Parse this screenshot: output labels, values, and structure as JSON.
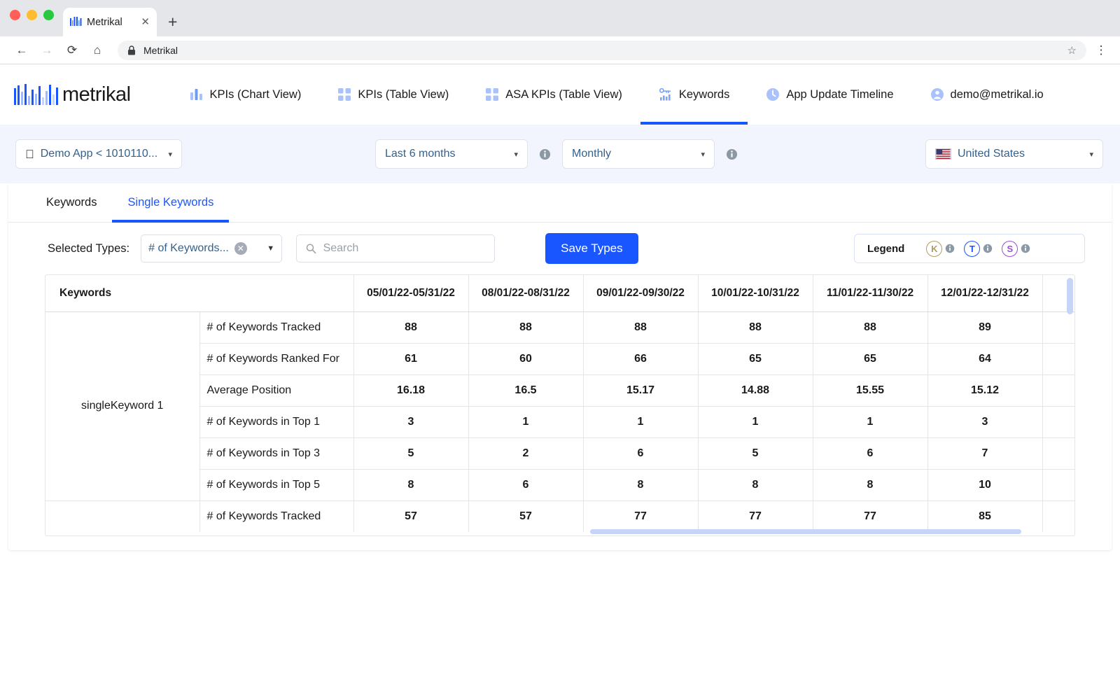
{
  "browser": {
    "tab_title": "Metrikal",
    "tab_close": "✕",
    "new_tab": "+",
    "back_icon": "←",
    "forward_icon": "→",
    "reload_icon": "⟳",
    "home_icon": "⌂",
    "lock_icon": "lock-icon",
    "url_text": "Metrikal",
    "bookmark_icon": "☆",
    "menu_icon": "⋮"
  },
  "header": {
    "logo_text": "metrikal",
    "nav": [
      {
        "label": "KPIs (Chart View)",
        "icon": "bar-chart-icon",
        "active": false
      },
      {
        "label": "KPIs (Table View)",
        "icon": "grid-icon",
        "active": false
      },
      {
        "label": "ASA KPIs (Table View)",
        "icon": "grid-icon",
        "active": false
      },
      {
        "label": "Keywords",
        "icon": "key-chart-icon",
        "active": true
      },
      {
        "label": "App Update Timeline",
        "icon": "clock-icon",
        "active": false
      },
      {
        "label": "demo@metrikal.io",
        "icon": "user-icon",
        "active": false
      }
    ]
  },
  "filters": {
    "app_selector": "Demo App < 1010110...",
    "app_icon": "apple-icon",
    "date_range": "Last 6 months",
    "granularity": "Monthly",
    "country": "United States",
    "country_flag": "us-flag-icon",
    "info_icon": "info-icon",
    "caret_icon": "▼"
  },
  "card": {
    "tabs": [
      {
        "label": "Keywords",
        "active": false
      },
      {
        "label": "Single Keywords",
        "active": true
      }
    ],
    "toolbar": {
      "selected_types_label": "Selected Types:",
      "selected_types_value": "# of Keywords...",
      "clear_icon": "✕",
      "dropdown_caret": "▼",
      "search_placeholder": "Search",
      "search_value": "",
      "search_icon": "search-icon",
      "save_button": "Save Types"
    },
    "legend": {
      "title": "Legend",
      "items": [
        {
          "letter": "K",
          "color": "#b09b63"
        },
        {
          "letter": "T",
          "color": "#1a56ff"
        },
        {
          "letter": "S",
          "color": "#9b4dd8"
        }
      ],
      "info_icon": "info-icon"
    }
  },
  "table": {
    "keywords_header": "Keywords",
    "periods": [
      "05/01/22-05/31/22",
      "08/01/22-08/31/22",
      "09/01/22-09/30/22",
      "10/01/22-10/31/22",
      "11/01/22-11/30/22",
      "12/01/22-12/31/22"
    ],
    "group_label": "singleKeyword 1",
    "rows": [
      {
        "metric": "# of Keywords Tracked",
        "values": [
          "88",
          "88",
          "88",
          "88",
          "88",
          "89"
        ]
      },
      {
        "metric": "# of Keywords Ranked For",
        "values": [
          "61",
          "60",
          "66",
          "65",
          "65",
          "64"
        ]
      },
      {
        "metric": "Average Position",
        "values": [
          "16.18",
          "16.5",
          "15.17",
          "14.88",
          "15.55",
          "15.12"
        ]
      },
      {
        "metric": "# of Keywords in Top 1",
        "values": [
          "3",
          "1",
          "1",
          "1",
          "1",
          "3"
        ]
      },
      {
        "metric": "# of Keywords in Top 3",
        "values": [
          "5",
          "2",
          "6",
          "5",
          "6",
          "7"
        ]
      },
      {
        "metric": "# of Keywords in Top 5",
        "values": [
          "8",
          "6",
          "8",
          "8",
          "8",
          "10"
        ]
      }
    ],
    "overflow_row": {
      "metric": "# of Keywords Tracked",
      "values": [
        "57",
        "57",
        "77",
        "77",
        "77",
        "85"
      ]
    }
  },
  "colors": {
    "accent": "#1a56ff",
    "filter_bg": "#f2f5fd",
    "scrollbar": "#c6d4f7"
  }
}
